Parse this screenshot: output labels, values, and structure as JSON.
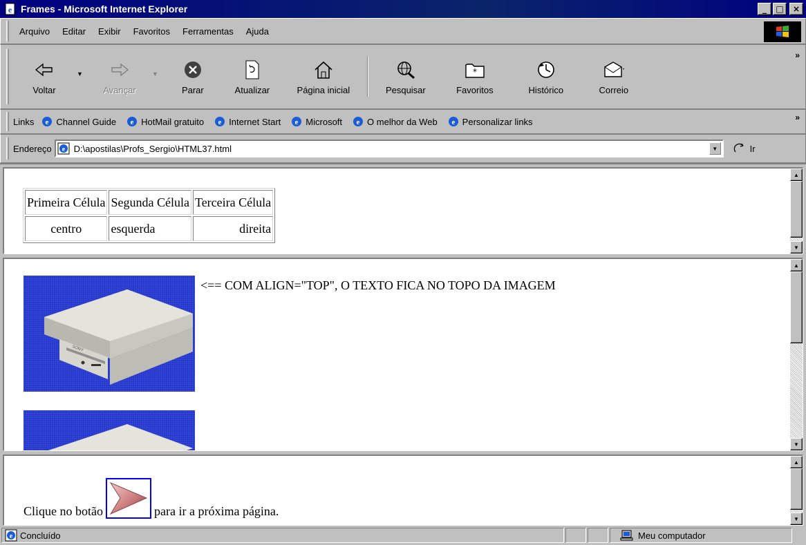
{
  "window": {
    "title": "Frames - Microsoft Internet Explorer",
    "controls": {
      "minimize": "_",
      "maximize": "□",
      "close": "×"
    }
  },
  "menu": [
    "Arquivo",
    "Editar",
    "Exibir",
    "Favoritos",
    "Ferramentas",
    "Ajuda"
  ],
  "toolbar": {
    "back": "Voltar",
    "forward": "Avançar",
    "stop": "Parar",
    "refresh": "Atualizar",
    "home": "Página inicial",
    "search": "Pesquisar",
    "favorites": "Favoritos",
    "history": "Histórico",
    "mail": "Correio"
  },
  "links": {
    "label": "Links",
    "items": [
      "Channel Guide",
      "HotMail gratuito",
      "Internet Start",
      "Microsoft",
      "O melhor da Web",
      "Personalizar links"
    ]
  },
  "address": {
    "label": "Endereço",
    "value": "D:\\apostilas\\Profs_Sergio\\HTML37.html",
    "go": "Ir"
  },
  "frame1": {
    "table": {
      "row1": [
        "Primeira Célula",
        "Segunda Célula",
        "Terceira Célula"
      ],
      "row2": [
        "centro",
        "esquerda",
        "direita"
      ]
    }
  },
  "frame2": {
    "caption": "<== COM ALIGN=\"TOP\", O TEXTO FICA NO TOPO DA IMAGEM",
    "image_label": "SONY"
  },
  "frame3": {
    "before": "Clique no botão",
    "after": "para ir a próxima página."
  },
  "status": {
    "text": "Concluído",
    "zone": "Meu computador"
  },
  "colors": {
    "titlebar": "#000080",
    "chrome": "#c0c0c0",
    "image_bg": "#2738c8",
    "link_border": "#0000ff"
  },
  "icons": {
    "app": "ie-page-icon",
    "back": "back-arrow-icon",
    "forward": "forward-arrow-icon",
    "stop": "stop-icon",
    "refresh": "refresh-icon",
    "home": "home-icon",
    "search": "search-globe-icon",
    "favorites": "favorites-folder-icon",
    "history": "history-icon",
    "mail": "mail-icon",
    "next": "next-arrow-icon"
  }
}
